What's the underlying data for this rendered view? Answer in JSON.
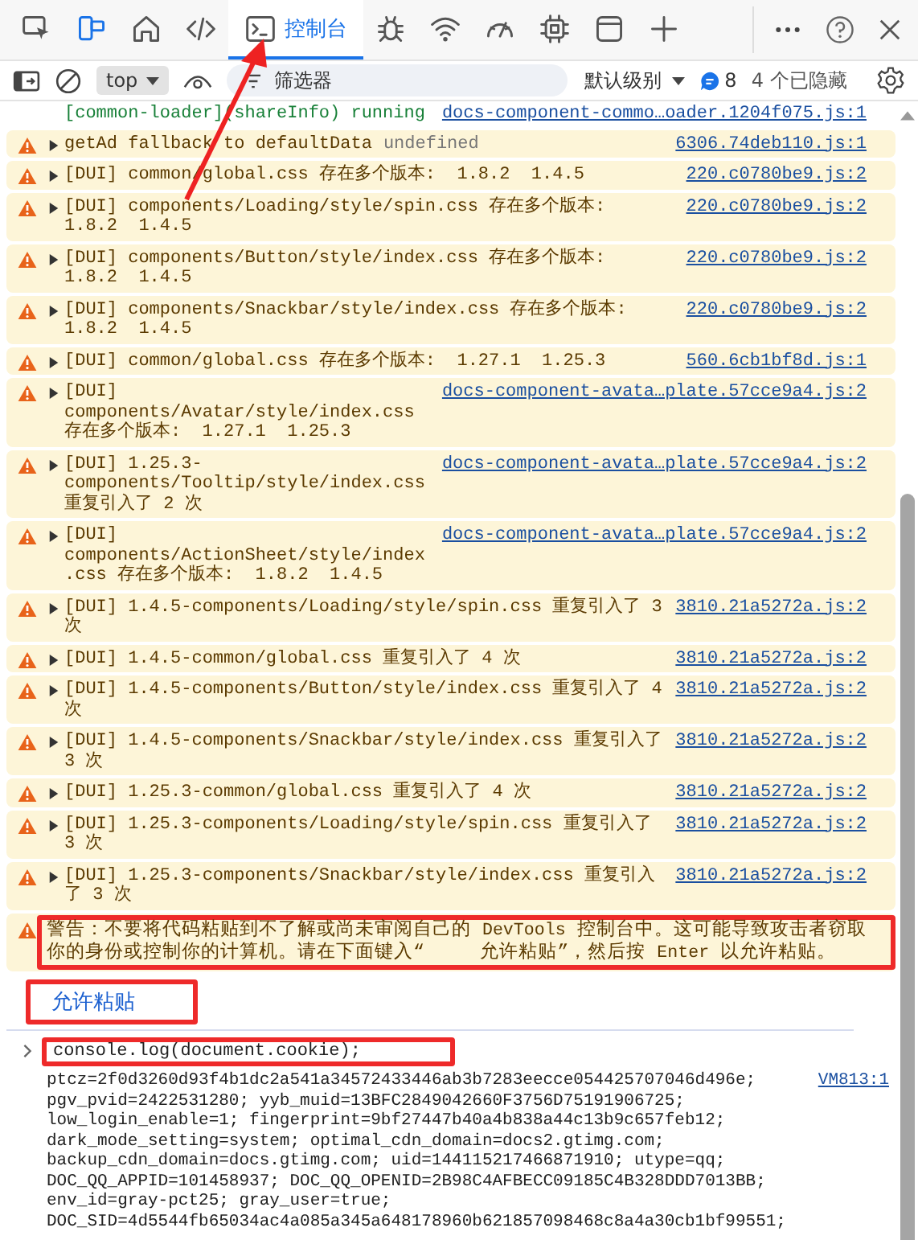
{
  "tabs": [
    {
      "kind": "inspect",
      "selected": false
    },
    {
      "kind": "device",
      "selected": false
    },
    {
      "kind": "home",
      "selected": false
    },
    {
      "kind": "code",
      "selected": false
    },
    {
      "kind": "console",
      "label": "控制台",
      "selected": true
    },
    {
      "kind": "bug",
      "selected": false
    },
    {
      "kind": "wifi",
      "selected": false
    },
    {
      "kind": "gauge",
      "selected": false
    },
    {
      "kind": "chip",
      "selected": false
    },
    {
      "kind": "window",
      "selected": false
    },
    {
      "kind": "plus",
      "selected": false
    }
  ],
  "filter_bar": {
    "context": "top",
    "filter_placeholder": "筛选器",
    "log_level": "默认级别",
    "message_count": "8",
    "hidden_count": "4 个已隐藏"
  },
  "messages": [
    {
      "kind": "info",
      "text": "[common-loader](shareInfo) running",
      "source": "docs-component-commo…oader.1204f075.js:1"
    },
    {
      "kind": "warning",
      "expanded": false,
      "text": "getAd fallback to defaultData",
      "detail": "undefined",
      "source": "6306.74deb110.js:1"
    },
    {
      "kind": "warning",
      "expanded": false,
      "text": "[DUI] common/global.css 存在多个版本:  1.8.2  1.4.5",
      "source": "220.c0780be9.js:2"
    },
    {
      "kind": "warning",
      "expanded": false,
      "text": "[DUI] components/Loading/style/spin.css 存在多个版本:  1.8.2  1.4.5",
      "source": "220.c0780be9.js:2"
    },
    {
      "kind": "warning",
      "expanded": false,
      "text": "[DUI] components/Button/style/index.css 存在多个版本:  1.8.2  1.4.5",
      "source": "220.c0780be9.js:2"
    },
    {
      "kind": "warning",
      "expanded": false,
      "text": "[DUI] components/Snackbar/style/index.css 存在多个版本:  1.8.2  1.4.5",
      "source": "220.c0780be9.js:2"
    },
    {
      "kind": "warning",
      "expanded": false,
      "text": "[DUI] common/global.css 存在多个版本:  1.27.1  1.25.3",
      "source": "560.6cb1bf8d.js:1"
    },
    {
      "kind": "warning",
      "expanded": false,
      "text": "[DUI] components/Avatar/style/index.css 存在多个版本:  1.27.1  1.25.3",
      "source": "docs-component-avata…plate.57cce9a4.js:2"
    },
    {
      "kind": "warning",
      "expanded": false,
      "text": "[DUI] 1.25.3-components/Tooltip/style/index.css 重复引入了 2 次",
      "source": "docs-component-avata…plate.57cce9a4.js:2"
    },
    {
      "kind": "warning",
      "expanded": false,
      "text": "[DUI] components/ActionSheet/style/index.css 存在多个版本:  1.8.2  1.4.5",
      "source": "docs-component-avata…plate.57cce9a4.js:2"
    },
    {
      "kind": "warning",
      "expanded": false,
      "text": "[DUI] 1.4.5-components/Loading/style/spin.css 重复引入了 3 次",
      "source": "3810.21a5272a.js:2"
    },
    {
      "kind": "warning",
      "expanded": false,
      "text": "[DUI] 1.4.5-common/global.css 重复引入了 4 次",
      "source": "3810.21a5272a.js:2"
    },
    {
      "kind": "warning",
      "expanded": false,
      "text": "[DUI] 1.4.5-components/Button/style/index.css 重复引入了 4 次",
      "source": "3810.21a5272a.js:2"
    },
    {
      "kind": "warning",
      "expanded": false,
      "text": "[DUI] 1.4.5-components/Snackbar/style/index.css 重复引入了 3 次",
      "source": "3810.21a5272a.js:2"
    },
    {
      "kind": "warning",
      "expanded": false,
      "text": "[DUI] 1.25.3-common/global.css 重复引入了 4 次",
      "source": "3810.21a5272a.js:2"
    },
    {
      "kind": "warning",
      "expanded": false,
      "text": "[DUI] 1.25.3-components/Loading/style/spin.css 重复引入了 3 次",
      "source": "3810.21a5272a.js:2"
    },
    {
      "kind": "warning",
      "expanded": false,
      "text": "[DUI] 1.25.3-components/Snackbar/style/index.css 重复引入了 3 次",
      "source": "3810.21a5272a.js:2"
    }
  ],
  "paste_warning": {
    "highlighted": true,
    "parts": [
      {
        "kind": "text",
        "text": "警告：不要将代码粘贴到不了解或尚未审阅自己的 "
      },
      {
        "kind": "code",
        "text": "DevTools"
      },
      {
        "kind": "text",
        "text": " 控制台中。这可能导致攻击者窃取你的身份或控制你的计算机。请在下面键入“     允许粘贴”，然后按 "
      },
      {
        "kind": "code",
        "text": "Enter"
      },
      {
        "kind": "text",
        "text": " 以允许粘贴。"
      }
    ]
  },
  "allow_paste": {
    "label": "允许粘贴",
    "highlighted": true
  },
  "input": {
    "code": "console.log(document.cookie);",
    "highlighted": true
  },
  "output": {
    "text": "ptcz=2f0d3260d93f4b1dc2a541a34572433446ab3b7283eecce054425707046d496e; pgv_pvid=2422531280; yyb_muid=13BFC2849042660F3756D75191906725; low_login_enable=1; fingerprint=9bf27447b40a4b838a44c13b9c657feb12; dark_mode_setting=system; optimal_cdn_domain=docs2.gtimg.com; backup_cdn_domain=docs.gtimg.com; uid=144115217466871910; utype=qq; DOC_QQ_APPID=101458937; DOC_QQ_OPENID=2B98C4AFBECC09185C4B328DDD7013BB; env_id=gray-pct25; gray_user=true; DOC_SID=4d5544fb65034ac4a085a345a648178960b621857098468c8a4a30cb1bf99551;",
    "source": "VM813:1"
  }
}
